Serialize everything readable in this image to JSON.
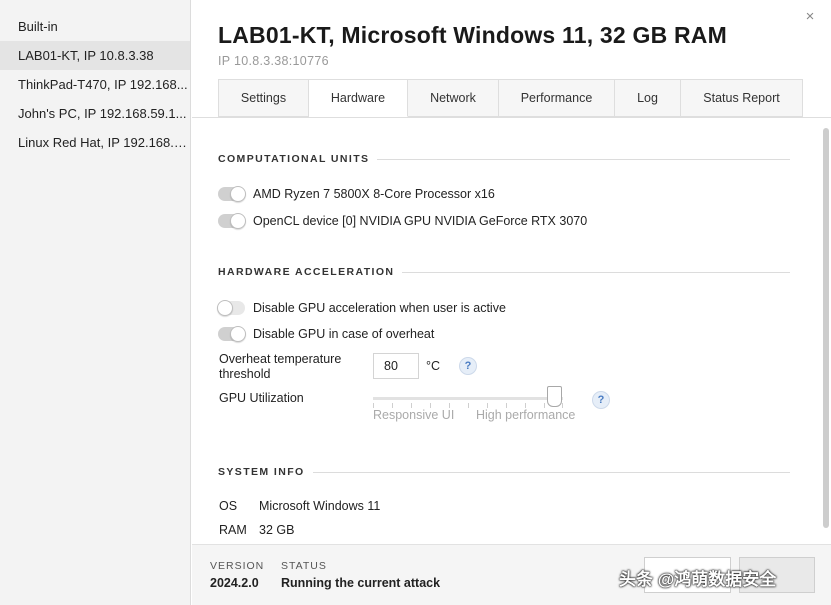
{
  "sidebar": {
    "items": [
      {
        "label": "Built-in"
      },
      {
        "label": "LAB01-KT, IP 10.8.3.38"
      },
      {
        "label": "ThinkPad-T470, IP 192.168..."
      },
      {
        "label": "John's PC, IP 192.168.59.1..."
      },
      {
        "label": "Linux Red Hat, IP 192.168.1..."
      }
    ]
  },
  "header": {
    "title": "LAB01-KT, Microsoft Windows 11, 32 GB RAM",
    "subtitle": "IP 10.8.3.38:10776",
    "close_icon": "×"
  },
  "tabs": [
    {
      "label": "Settings"
    },
    {
      "label": "Hardware"
    },
    {
      "label": "Network"
    },
    {
      "label": "Performance"
    },
    {
      "label": "Log"
    },
    {
      "label": "Status Report"
    }
  ],
  "computational_units": {
    "heading": "COMPUTATIONAL UNITS",
    "items": [
      {
        "label": "AMD Ryzen 7 5800X 8-Core Processor x16",
        "enabled": true
      },
      {
        "label": "OpenCL device [0] NVIDIA GPU NVIDIA GeForce RTX 3070",
        "enabled": true
      }
    ]
  },
  "hardware_acceleration": {
    "heading": "HARDWARE ACCELERATION",
    "disable_gpu_active": {
      "label": "Disable GPU acceleration when user is active",
      "enabled": false
    },
    "disable_gpu_overheat": {
      "label": "Disable GPU in case of overheat",
      "enabled": true
    },
    "overheat_threshold": {
      "label_line1": "Overheat temperature",
      "label_line2": "threshold",
      "value": "80",
      "unit": "°C",
      "help": "?"
    },
    "gpu_utilization": {
      "label": "GPU Utilization",
      "level_fraction": 0.95,
      "min_label": "Responsive UI",
      "max_label": "High performance",
      "help": "?"
    }
  },
  "system_info": {
    "heading": "SYSTEM INFO",
    "os_key": "OS",
    "os_value": "Microsoft Windows 11",
    "ram_key": "RAM",
    "ram_value": "32 GB"
  },
  "footer": {
    "version_label": "VERSION",
    "version_value": "2024.2.0",
    "status_label": "STATUS",
    "status_value": "Running the current attack",
    "watermark": "头条 @鸿萌数据安全"
  },
  "colors": {
    "sidebar_bg": "#f3f3f3",
    "selected_bg": "#e4e4e4",
    "help_accent": "#4a7cc2"
  }
}
